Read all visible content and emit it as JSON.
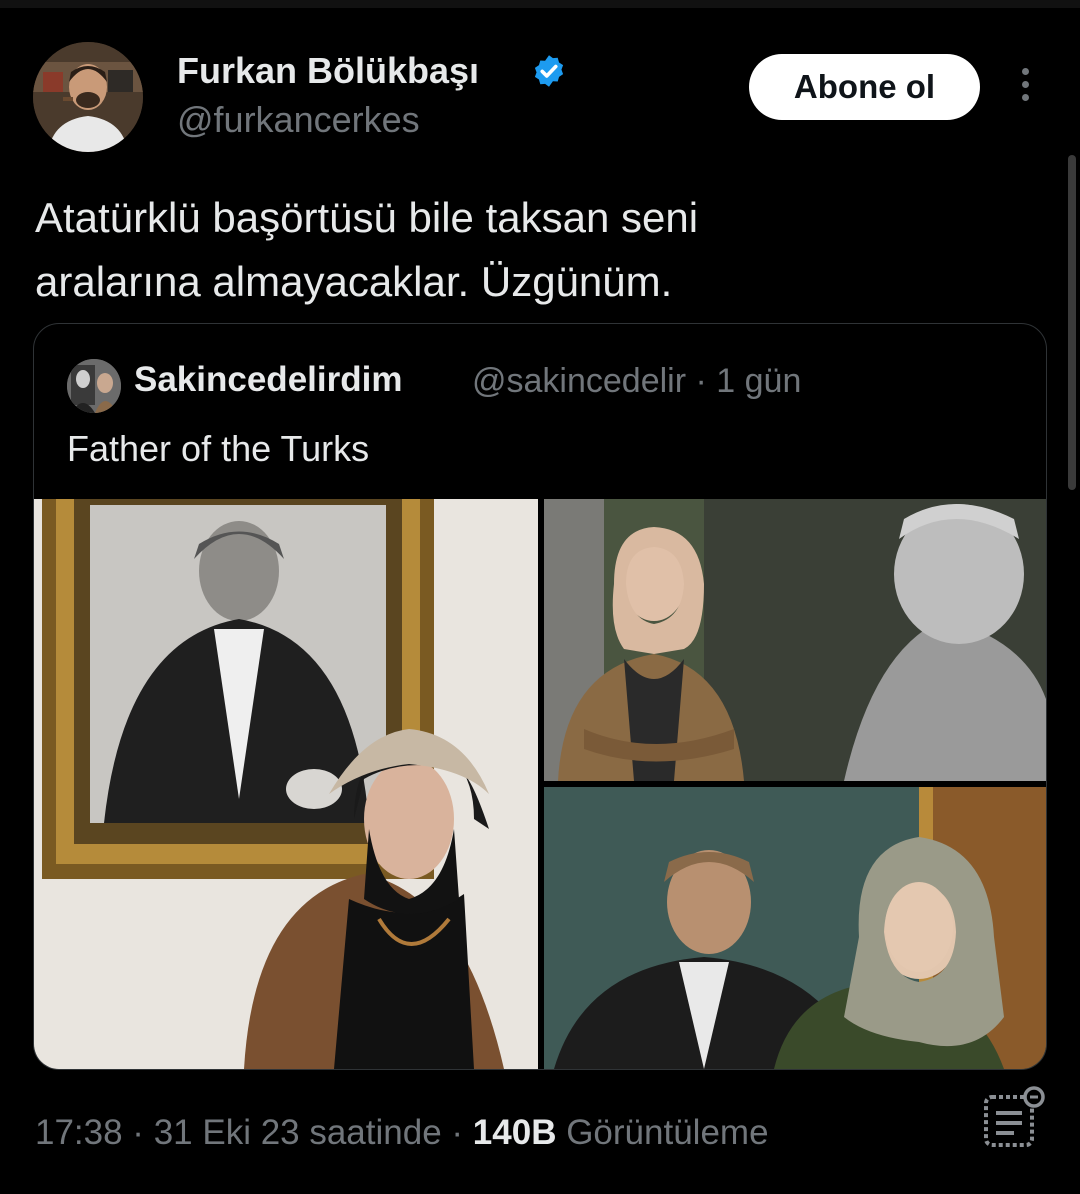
{
  "author": {
    "name": "Furkan Bölükbaşı",
    "handle": "@furkancerkes",
    "verified_color": "#1d9bf0"
  },
  "follow_label": "Abone ol",
  "tweet": {
    "lines": [
      "Atatürklü başörtüsü bile taksan seni",
      "aralarına almayacaklar. Üzgünüm."
    ]
  },
  "quote": {
    "name": "Sakincedelirdim",
    "handle": "@sakincedelir",
    "time": "· 1 gün",
    "text": "Father of the Turks"
  },
  "footer": {
    "time": "17:38 · 31 Eki 23 saatinde ·",
    "views": "140B",
    "views_label": "Görüntüleme"
  },
  "icons": [
    "verified-badge-icon",
    "more-options-icon",
    "analytics-icon"
  ]
}
